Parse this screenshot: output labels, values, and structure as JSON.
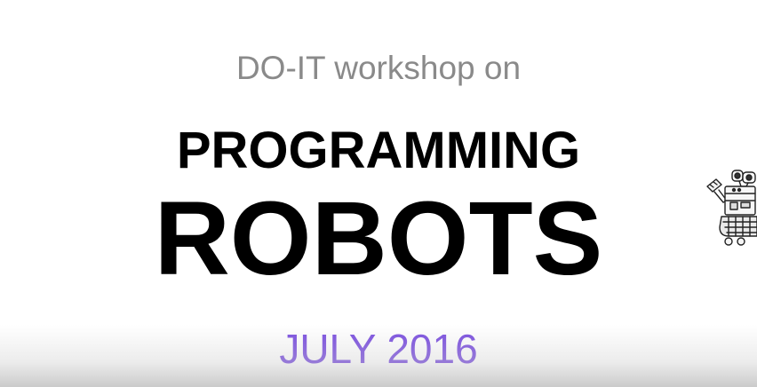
{
  "slide": {
    "subtitle": "DO-IT workshop on",
    "title_line_1": "PROGRAMMING",
    "title_line_2": "ROBOTS",
    "date": "JULY 2016"
  },
  "colors": {
    "subtitle": "#8a8a8a",
    "title": "#000000",
    "date": "#7b4fe0",
    "background": "#ffffff"
  },
  "icons": {
    "robot": "robot-illustration-icon"
  }
}
